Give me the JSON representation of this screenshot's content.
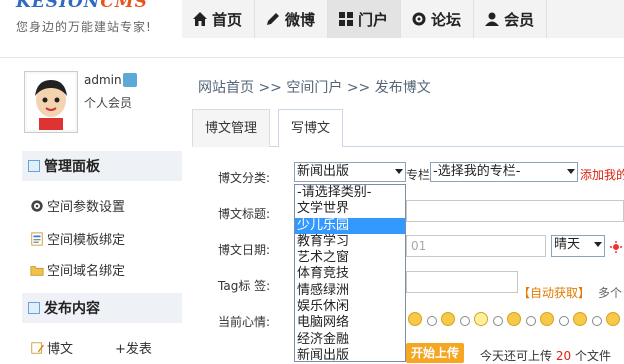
{
  "header": {
    "brand_main": "KESION",
    "brand_accent": "CMS",
    "slogan": "您身边的万能建站专家!",
    "nav": [
      {
        "label": "首页",
        "icon": "home-icon"
      },
      {
        "label": "微博",
        "icon": "pencil-icon"
      },
      {
        "label": "门户",
        "icon": "grid-icon"
      },
      {
        "label": "论坛",
        "icon": "gear-icon"
      },
      {
        "label": "会员",
        "icon": "user-icon"
      }
    ]
  },
  "user": {
    "name": "admin",
    "role": "个人会员"
  },
  "sidebar": {
    "panel_title": "管理面板",
    "panel_items": [
      {
        "label": "空间参数设置",
        "icon": "gear-icon"
      },
      {
        "label": "空间模板绑定",
        "icon": "template-icon"
      },
      {
        "label": "空间域名绑定",
        "icon": "folder-icon"
      }
    ],
    "content_title": "发布内容",
    "content_item": {
      "label": "博文",
      "add": "+发表"
    }
  },
  "breadcrumb": [
    "网站首页",
    ">>",
    "空间门户",
    ">>",
    "发布博文"
  ],
  "tabs": [
    {
      "label": "博文管理"
    },
    {
      "label": "写博文"
    }
  ],
  "form": {
    "category_label": "博文分类:",
    "category_value": "新闻出版",
    "column_label": "专栏",
    "column_value": "-选择我的专栏-",
    "add_column_link": "添加我的",
    "title_label": "博文标题:",
    "date_label": "博文日期:",
    "date_value_tail": "01",
    "weather_value": "晴天",
    "tag_label": "Tag标 签:",
    "auto_fetch": "【自动获取】",
    "multi_hint": "多个",
    "mood_label": "当前心情:",
    "upload_button": "开始上传",
    "upload_text_prefix": "今天还可上传",
    "upload_count": "20",
    "upload_text_suffix": "个文件"
  },
  "category_options": [
    "-请选择类别-",
    "文学世界",
    "少儿乐园",
    "教育学习",
    "艺术之窗",
    "体育竞技",
    "情感绿洲",
    "娱乐休闲",
    "电脑网络",
    "经济金融",
    "新闻出版"
  ],
  "highlighted_option_index": 2,
  "colors": {
    "accent_blue": "#3399ff",
    "brand_orange": "#e5561f",
    "link_red": "#d21"
  }
}
